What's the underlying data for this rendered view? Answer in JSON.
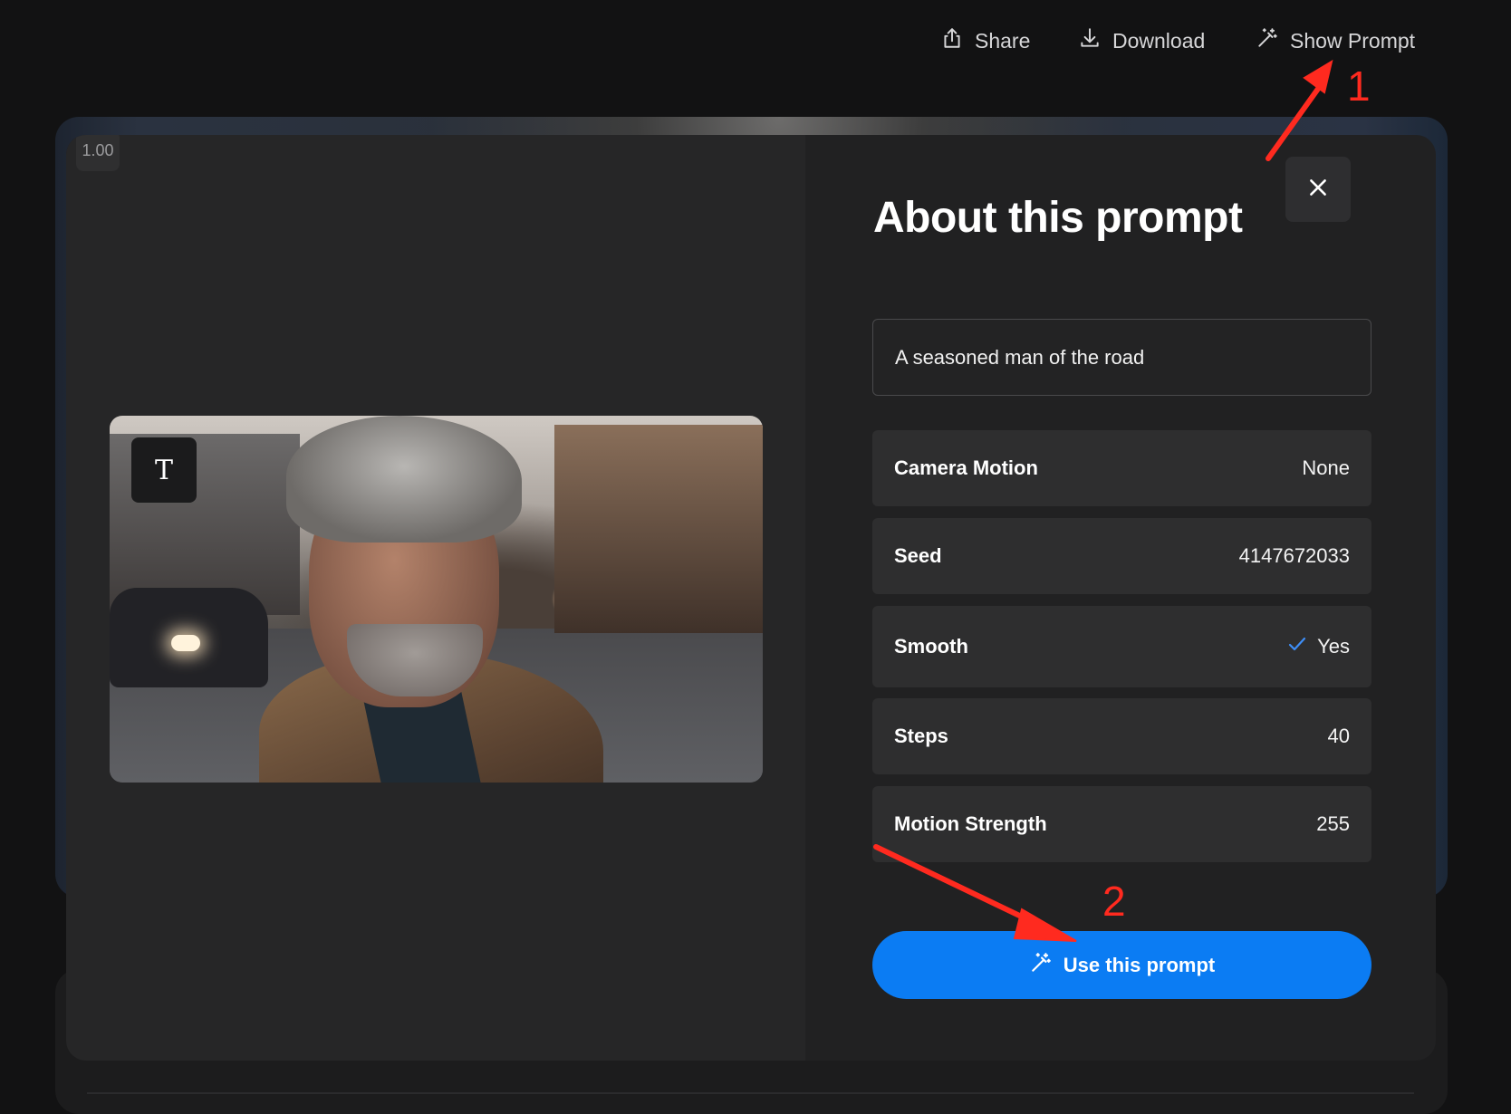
{
  "toolbar": {
    "share_label": "Share",
    "download_label": "Download",
    "show_prompt_label": "Show Prompt"
  },
  "zoom": {
    "value": "1.00"
  },
  "preview": {
    "type_badge": "T"
  },
  "modal": {
    "title": "About this prompt",
    "prompt_text": "A seasoned man of the road",
    "params": [
      {
        "label": "Camera Motion",
        "value": "None"
      },
      {
        "label": "Seed",
        "value": "4147672033"
      },
      {
        "label": "Smooth",
        "value": "Yes",
        "checked": true
      },
      {
        "label": "Steps",
        "value": "40"
      },
      {
        "label": "Motion Strength",
        "value": "255"
      }
    ],
    "use_button_label": "Use this prompt"
  },
  "annotations": {
    "first": "1",
    "second": "2"
  },
  "colors": {
    "accent": "#0b7cf3",
    "annotation": "#ff2a1f",
    "panel": "#212122",
    "row": "#2e2e2f"
  },
  "icons": [
    "share-icon",
    "download-icon",
    "magic-wand-icon",
    "close-icon",
    "check-icon"
  ]
}
